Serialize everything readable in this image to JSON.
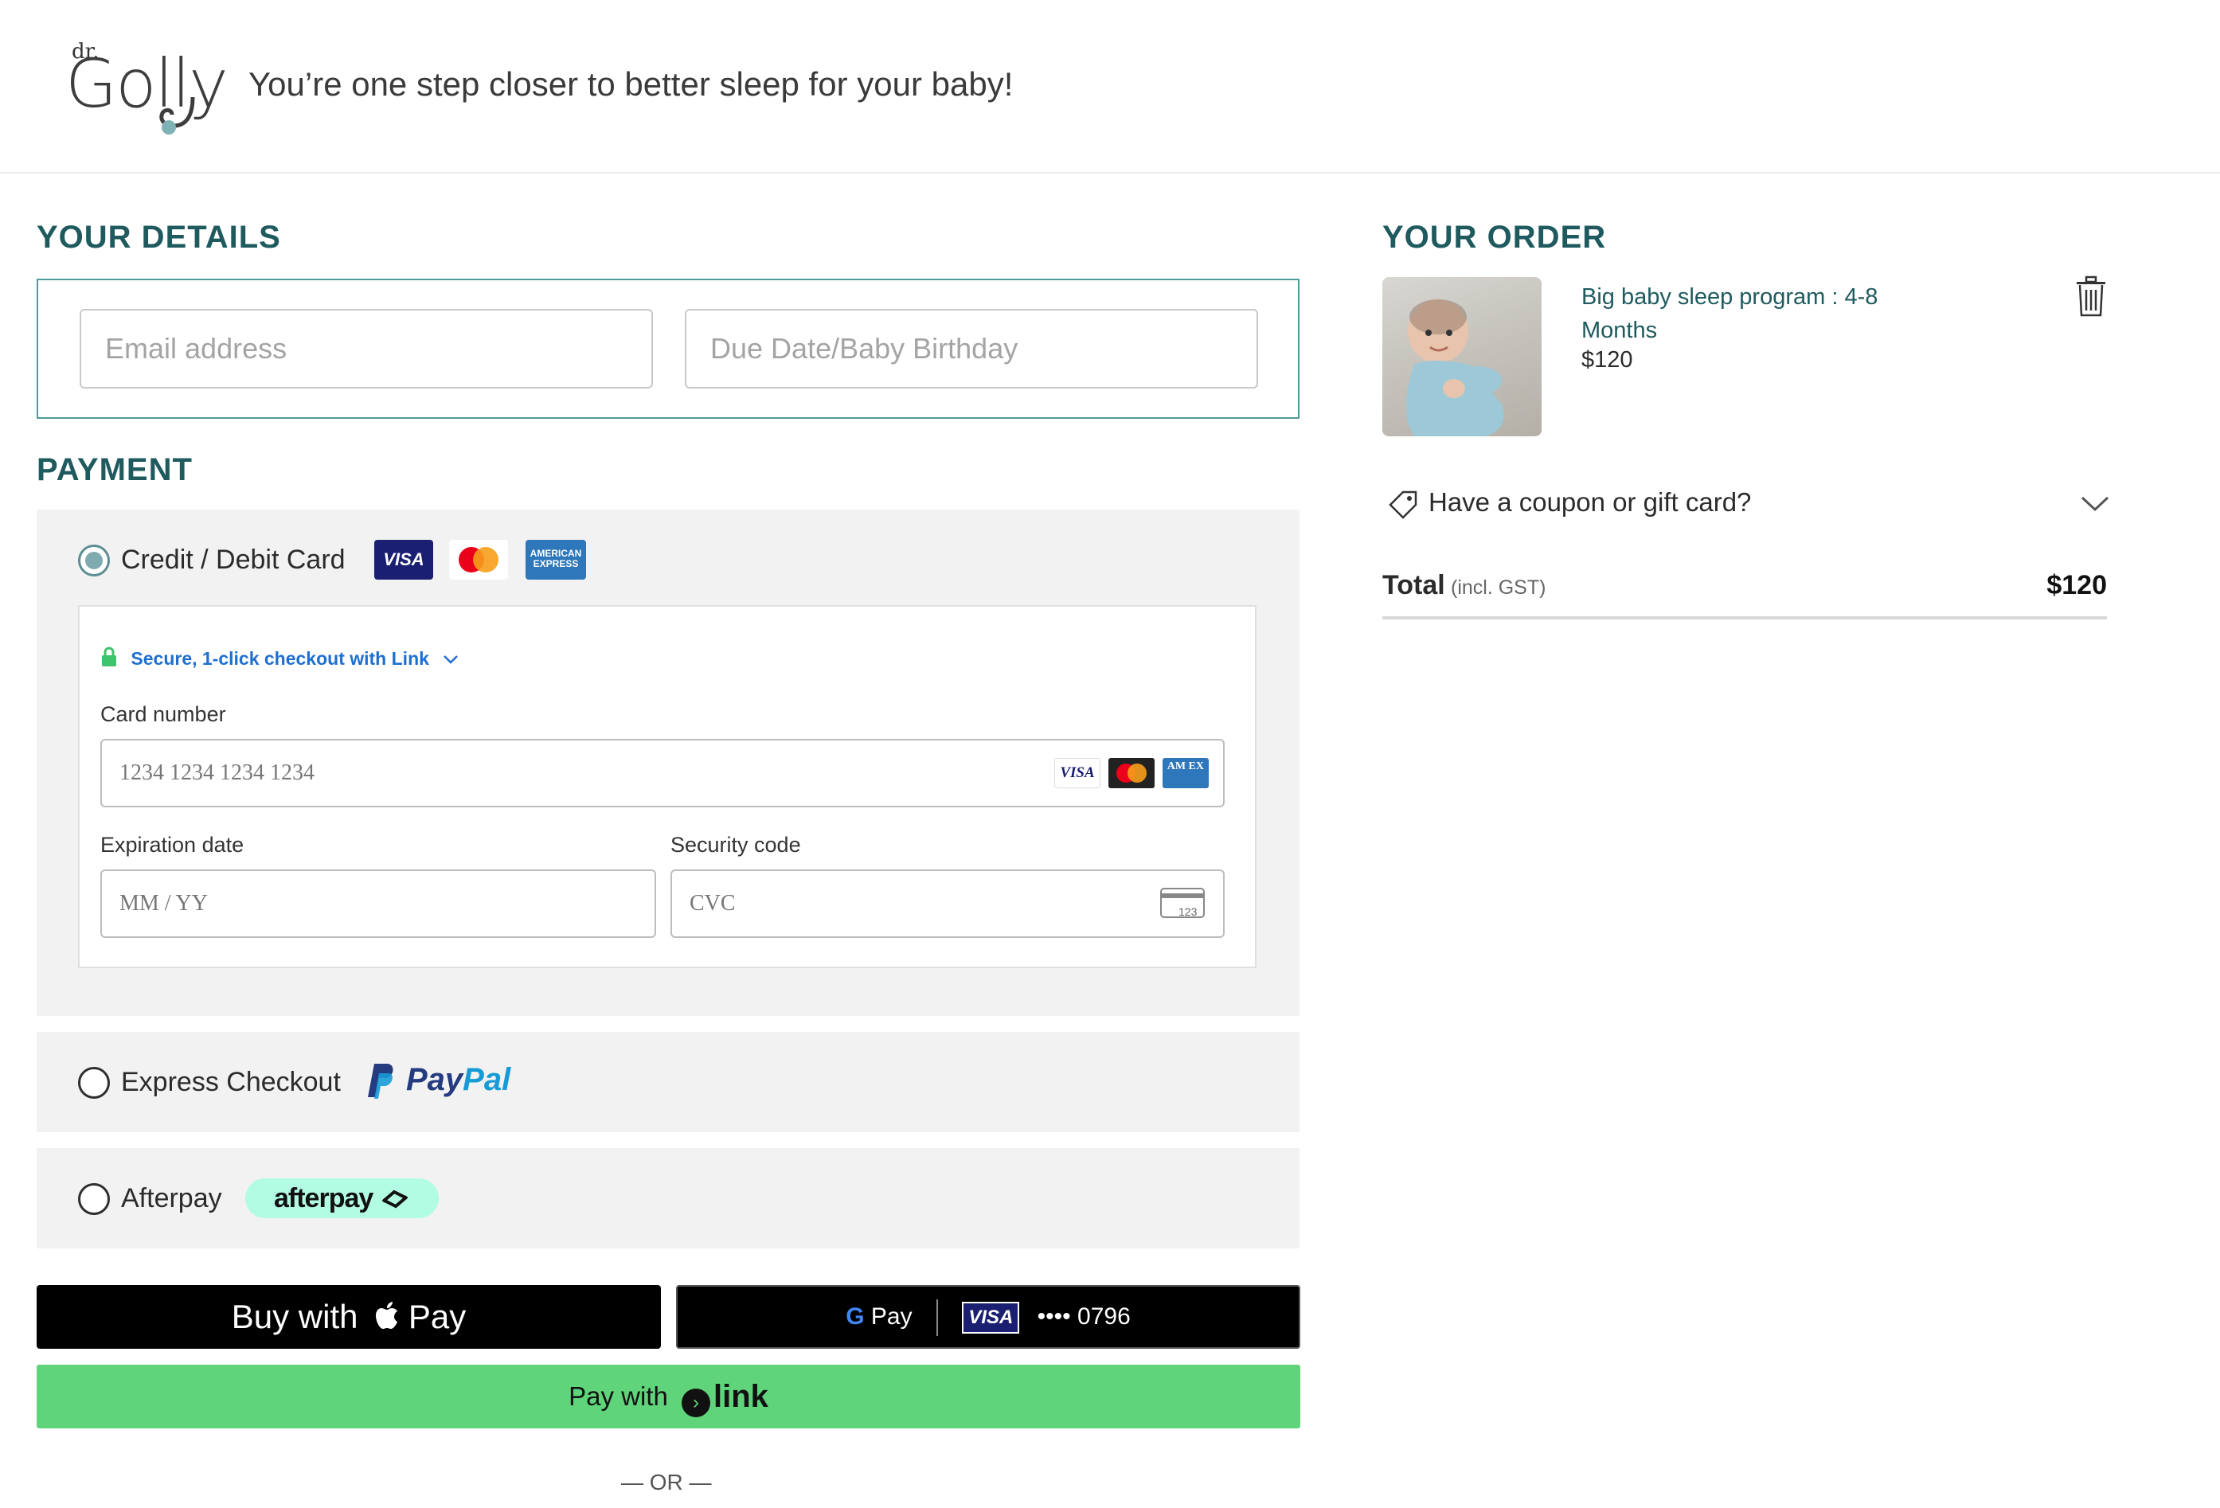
{
  "header": {
    "logo_dr": "dr.",
    "logo_word": "Golly",
    "tagline": "You’re one step closer to better sleep for your baby!"
  },
  "details": {
    "title": "YOUR DETAILS",
    "email_placeholder": "Email address",
    "date_placeholder": "Due Date/Baby Birthday"
  },
  "payment": {
    "title": "PAYMENT",
    "credit": {
      "label": "Credit / Debit Card",
      "visa": "VISA",
      "amex": "AMERICAN EXPRESS",
      "link_text": "Secure, 1-click checkout with Link",
      "card_number_label": "Card number",
      "card_number_placeholder": "1234 1234 1234 1234",
      "mini_visa": "VISA",
      "mini_amex": "AM EX",
      "expiry_label": "Expiration date",
      "expiry_placeholder": "MM / YY",
      "cvc_label": "Security code",
      "cvc_placeholder": "CVC",
      "cvc_icon_text": "123"
    },
    "express": {
      "label": "Express Checkout",
      "paypal_1": "Pay",
      "paypal_2": "Pal"
    },
    "afterpay": {
      "label": "Afterpay",
      "pill": "afterpay"
    }
  },
  "wallets": {
    "apple_prefix": "Buy with",
    "apple_pay": "Pay",
    "gpay_g": "G",
    "gpay_pay": "Pay",
    "gpay_visa": "VISA",
    "gpay_card": "•••• 0796",
    "link_prefix": "Pay with",
    "link_word": "link",
    "or": "— OR —"
  },
  "order": {
    "title": "YOUR ORDER",
    "product_name": "Big baby sleep program : 4-8 Months",
    "product_price": "$120",
    "coupon_label": "Have a coupon or gift card?",
    "total_label": "Total",
    "total_sub": "(incl. GST)",
    "total_amount": "$120"
  },
  "colors": {
    "brand_teal": "#1f5a5e",
    "link_green": "#5fd47a",
    "link_blue": "#1f6fd1",
    "afterpay_mint": "#b2fce4"
  }
}
